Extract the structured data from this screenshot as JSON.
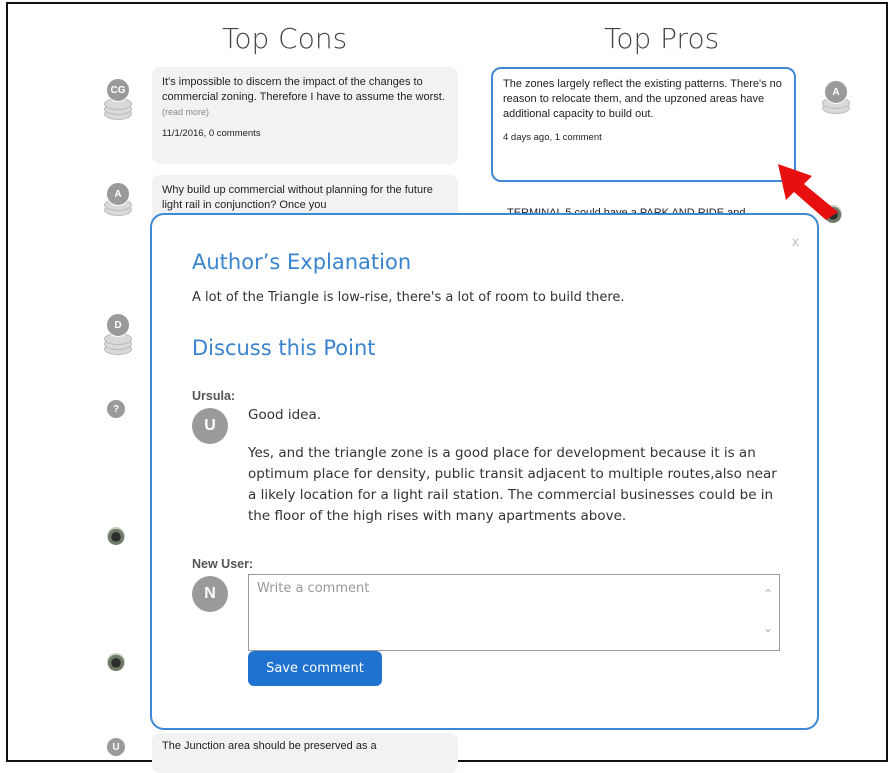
{
  "columns": {
    "cons_title": "Top Cons",
    "pros_title": "Top Pros"
  },
  "cons": [
    {
      "avatar": "CG",
      "text": "It's impossible to discern the impact of the changes to commercial zoning. Therefore I have to assume the worst.",
      "more": "(read more)",
      "meta": "11/1/2016, 0 comments"
    },
    {
      "avatar": "A",
      "text": "Why build up commercial without planning for the future light rail in conjunction? Once you"
    },
    {
      "avatar": "D"
    },
    {
      "avatar": "?"
    },
    {
      "avatar": "photo"
    },
    {
      "avatar": "photo"
    },
    {
      "avatar": "U",
      "text": "The Junction area should be preserved as a"
    }
  ],
  "pros": [
    {
      "avatar": "A",
      "text": "The zones largely reflect the existing patterns. There's no reason to relocate them, and the upzoned areas have additional capacity to build out.",
      "meta": "4 days ago, 1 comment"
    },
    {
      "avatar": "photo",
      "text": "TERMINAL 5 could have a PARK AND RIDE and"
    }
  ],
  "modal": {
    "close": "x",
    "explanation_title": "Author’s Explanation",
    "explanation": "A lot of the Triangle is low-rise, there's a lot of room to build there.",
    "discuss_title": "Discuss this Point",
    "comment": {
      "author": "Ursula:",
      "initial": "U",
      "line1": "Good idea.",
      "body": "Yes, and the triangle zone is a good place for development because it is an optimum place for density, public transit adjacent to multiple routes,also near a likely location for a light rail station. The commercial businesses could be in the floor of the high rises with many apartments above."
    },
    "new_user": {
      "label": "New User:",
      "initial": "N",
      "placeholder": "Write a comment"
    },
    "save_label": "Save comment"
  },
  "colors": {
    "accent": "#3f88d6",
    "button": "#1f72cf",
    "arrow": "#e8100f"
  }
}
